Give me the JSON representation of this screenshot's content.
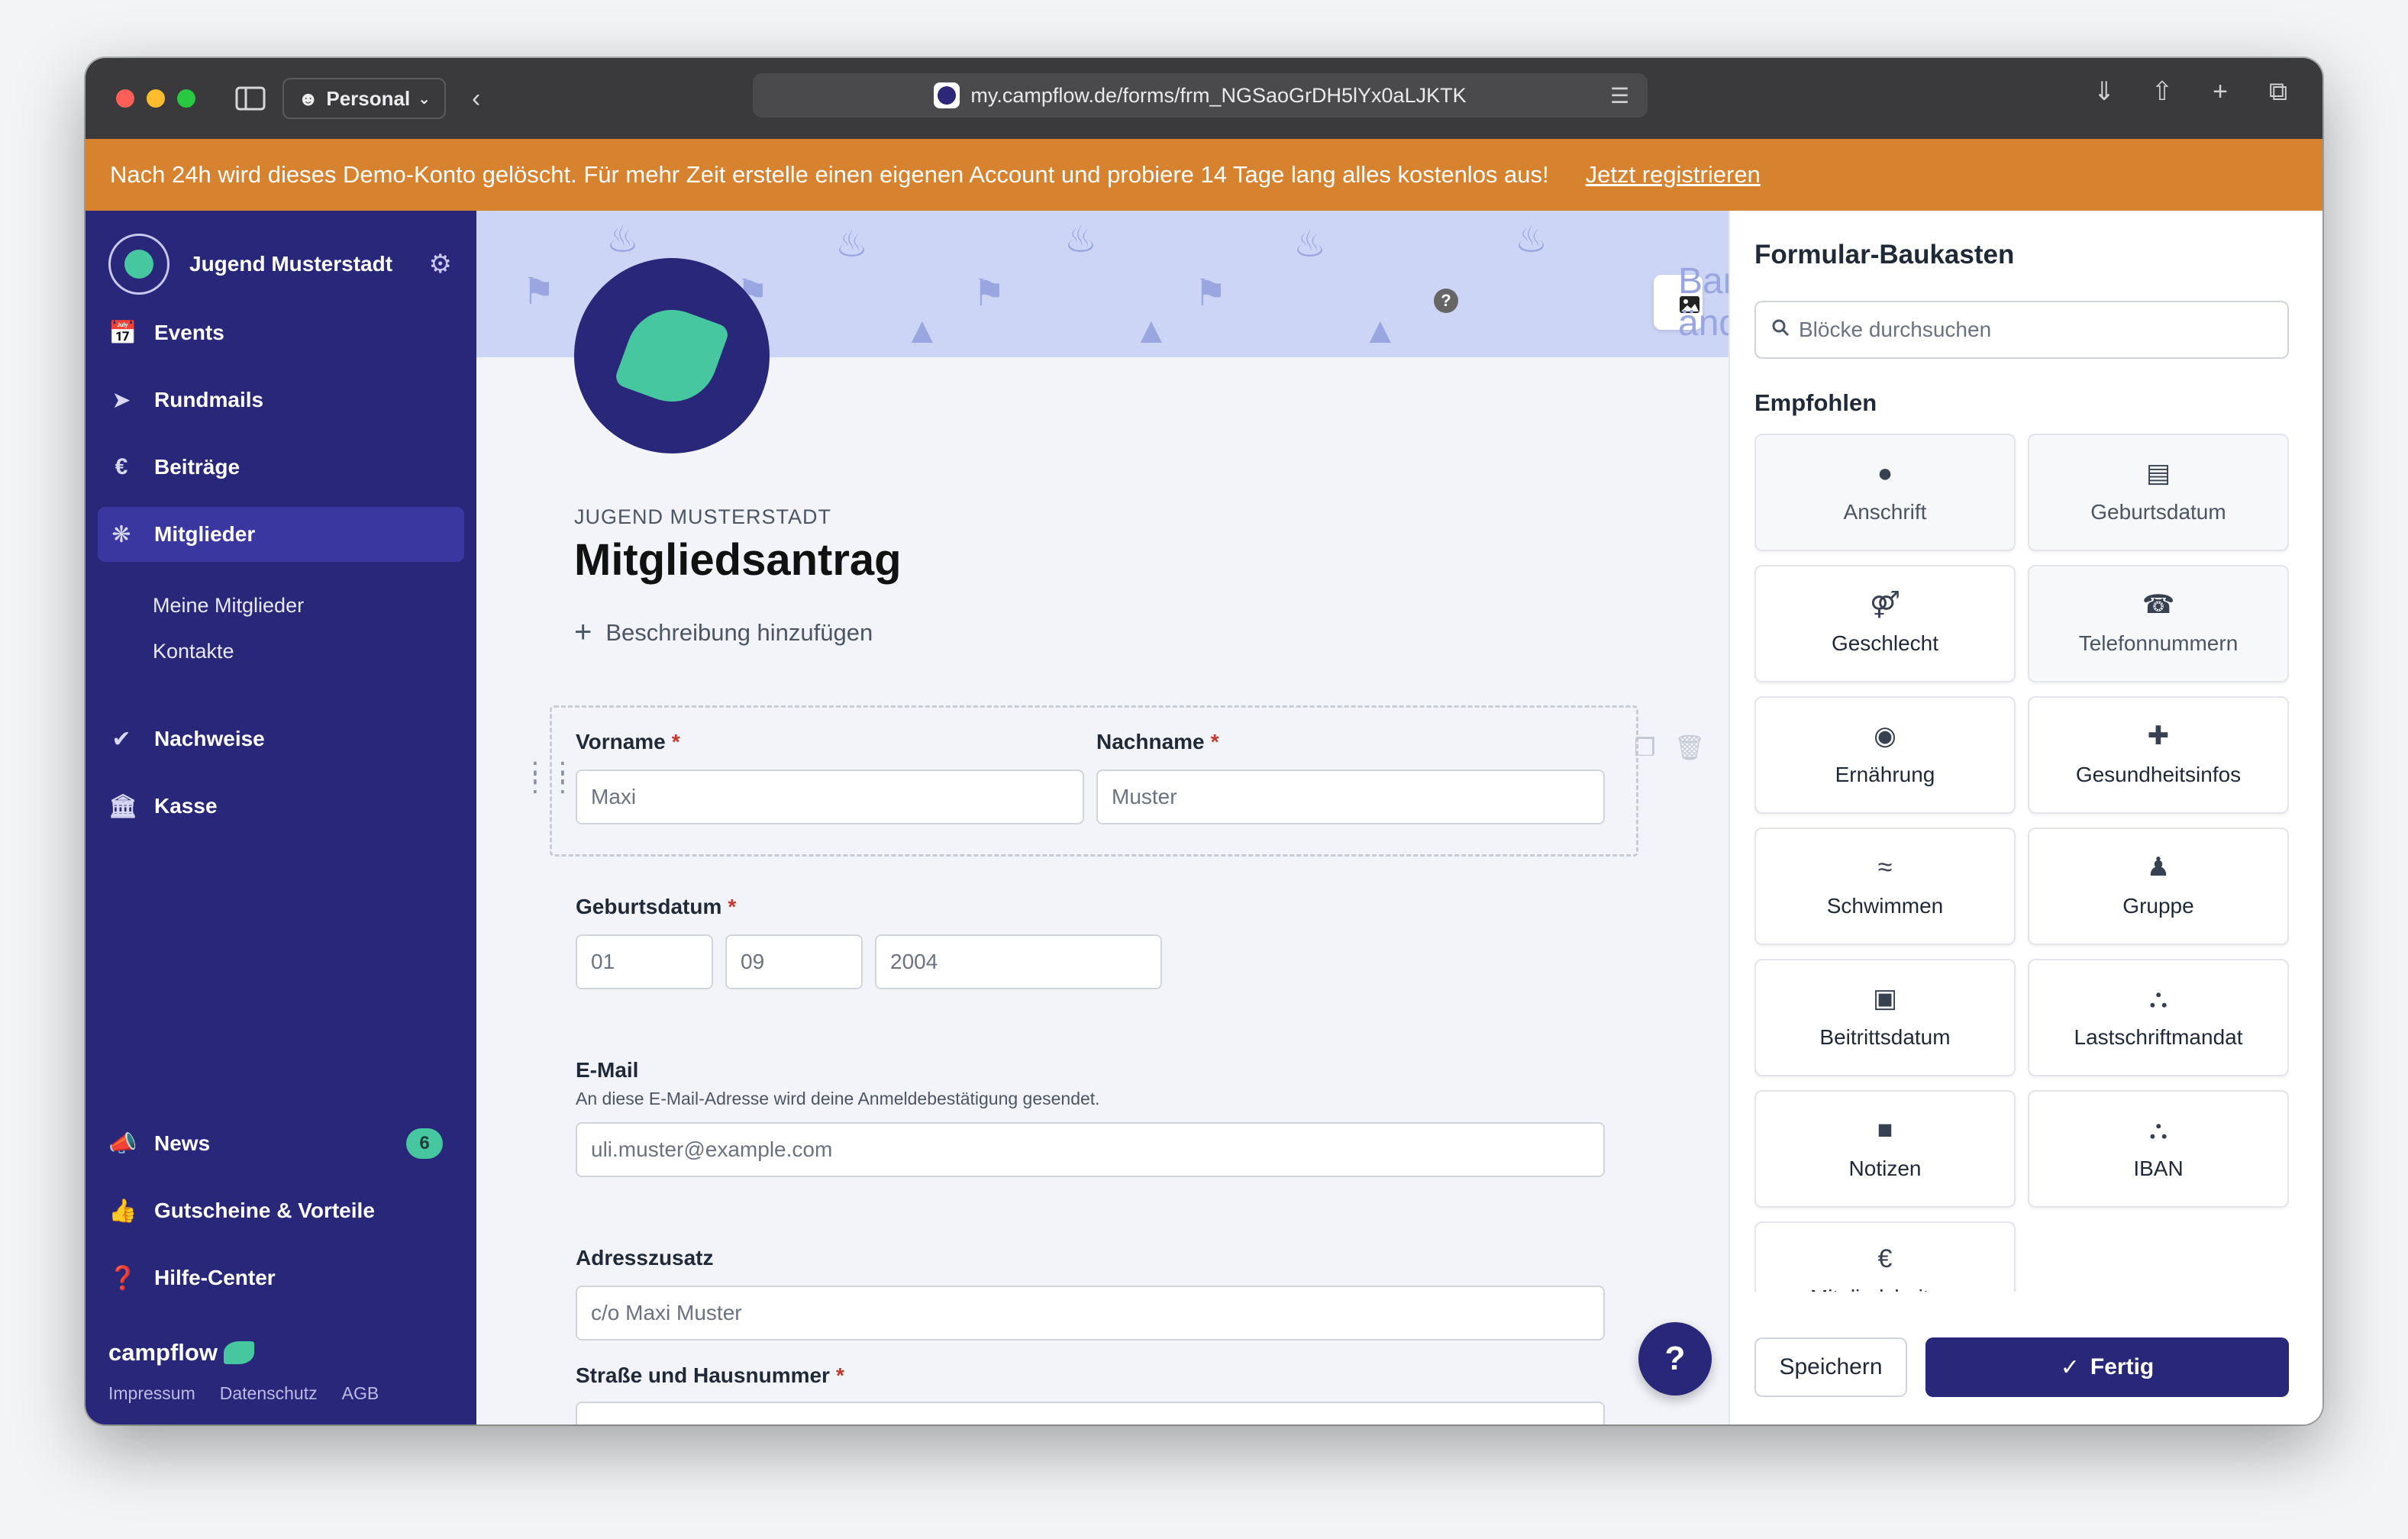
{
  "browser": {
    "profile": "Personal",
    "url": "my.campflow.de/forms/frm_NGSaoGrDH5lYx0aLJKTK"
  },
  "notice": {
    "text": "Nach 24h wird dieses Demo-Konto gelöscht.  Für mehr Zeit erstelle einen eigenen Account und probiere 14 Tage lang alles kostenlos aus!",
    "link": "Jetzt registrieren",
    "color": "#d6822f"
  },
  "sidebar": {
    "org_name": "Jugend Musterstadt",
    "items": [
      {
        "label": "Events",
        "icon": "calendar-icon"
      },
      {
        "label": "Rundmails",
        "icon": "paper-plane-icon"
      },
      {
        "label": "Beiträge",
        "icon": "euro-icon"
      },
      {
        "label": "Mitglieder",
        "icon": "people-icon"
      },
      {
        "label": "Nachweise",
        "icon": "check-icon"
      },
      {
        "label": "Kasse",
        "icon": "bank-icon"
      }
    ],
    "subitems": [
      "Meine Mitglieder",
      "Kontakte"
    ],
    "bottom_items": [
      {
        "label": "News",
        "icon": "megaphone-icon",
        "badge": "6"
      },
      {
        "label": "Gutscheine & Vorteile",
        "icon": "thumbs-up-icon"
      },
      {
        "label": "Hilfe-Center",
        "icon": "help-icon"
      }
    ],
    "brand": "campflow",
    "footer": [
      "Impressum",
      "Datenschutz",
      "AGB"
    ],
    "color": "#29277a"
  },
  "main": {
    "banner_button": "Banner ändern",
    "org_caption": "JUGEND MUSTERSTADT",
    "title": "Mitgliedsantrag",
    "add_description": "Beschreibung hinzufügen",
    "fields": {
      "vorname": {
        "label": "Vorname",
        "placeholder": "Maxi"
      },
      "nachname": {
        "label": "Nachname",
        "placeholder": "Muster"
      },
      "geburtsdatum": {
        "label": "Geburtsdatum",
        "day": "01",
        "month": "09",
        "year": "2004"
      },
      "email": {
        "label": "E-Mail",
        "hint": "An diese E-Mail-Adresse wird deine Anmeldebestätigung gesendet.",
        "placeholder": "uli.muster@example.com"
      },
      "adresszusatz": {
        "label": "Adresszusatz",
        "placeholder": "c/o Maxi Muster"
      },
      "strasse": {
        "label": "Straße und Hausnummer"
      }
    },
    "required_mark": "*"
  },
  "panel": {
    "title": "Formular-Baukasten",
    "search_placeholder": "Blöcke durchsuchen",
    "section": "Empfohlen",
    "blocks": [
      {
        "label": "Anschrift",
        "icon": "map-pin-icon",
        "dim": true
      },
      {
        "label": "Geburtsdatum",
        "icon": "cake-icon",
        "dim": true
      },
      {
        "label": "Geschlecht",
        "icon": "gender-icon",
        "dim": false
      },
      {
        "label": "Telefonnummern",
        "icon": "phone-icon",
        "dim": true
      },
      {
        "label": "Ernährung",
        "icon": "plate-icon",
        "dim": false
      },
      {
        "label": "Gesundheitsinfos",
        "icon": "health-chat-icon",
        "dim": false
      },
      {
        "label": "Schwimmen",
        "icon": "swimmer-icon",
        "dim": false
      },
      {
        "label": "Gruppe",
        "icon": "group-icon",
        "dim": false
      },
      {
        "label": "Beitrittsdatum",
        "icon": "calendar-icon",
        "dim": false
      },
      {
        "label": "Lastschriftmandat",
        "icon": "bank-icon",
        "dim": false
      },
      {
        "label": "Notizen",
        "icon": "note-icon",
        "dim": false
      },
      {
        "label": "IBAN",
        "icon": "bank-icon",
        "dim": false
      },
      {
        "label": "Mitgliedsbeitrag",
        "icon": "euro-icon",
        "dim": false
      }
    ],
    "save_label": "Speichern",
    "done_label": "Fertig"
  }
}
